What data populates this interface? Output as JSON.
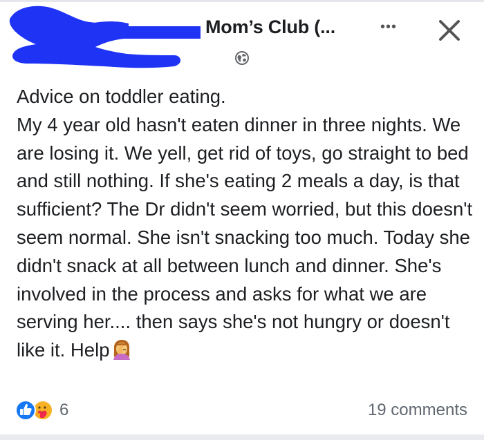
{
  "header": {
    "group_name": "Mom’s Club (...",
    "more_label": "•••",
    "close_icon": "close-icon",
    "privacy_icon": "globe-icon",
    "redaction_color": "#1f33f5"
  },
  "post": {
    "title": "Advice on toddler eating.",
    "body": "My 4 year old hasn't eaten dinner in three nights. We are losing it. We yell, get rid of toys, go straight to bed and still nothing. If she's eating 2 meals a day, is that sufficient? The Dr didn't seem worried, but this doesn't seem normal. She isn't snacking too much. Today she didn't snack at all between lunch and dinner. She's involved in the process and asks for what we are serving her.... then says she's not hungry or doesn't like it. Help",
    "trailing_emoji": "woman-facepalming-emoji"
  },
  "footer": {
    "reaction_icons": [
      "like-icon",
      "care-icon"
    ],
    "reaction_count": "6",
    "comments_label": "19 comments"
  },
  "colors": {
    "like_blue": "#1877f2",
    "care_yellow": "#f7b125",
    "meta_gray": "#606770"
  }
}
